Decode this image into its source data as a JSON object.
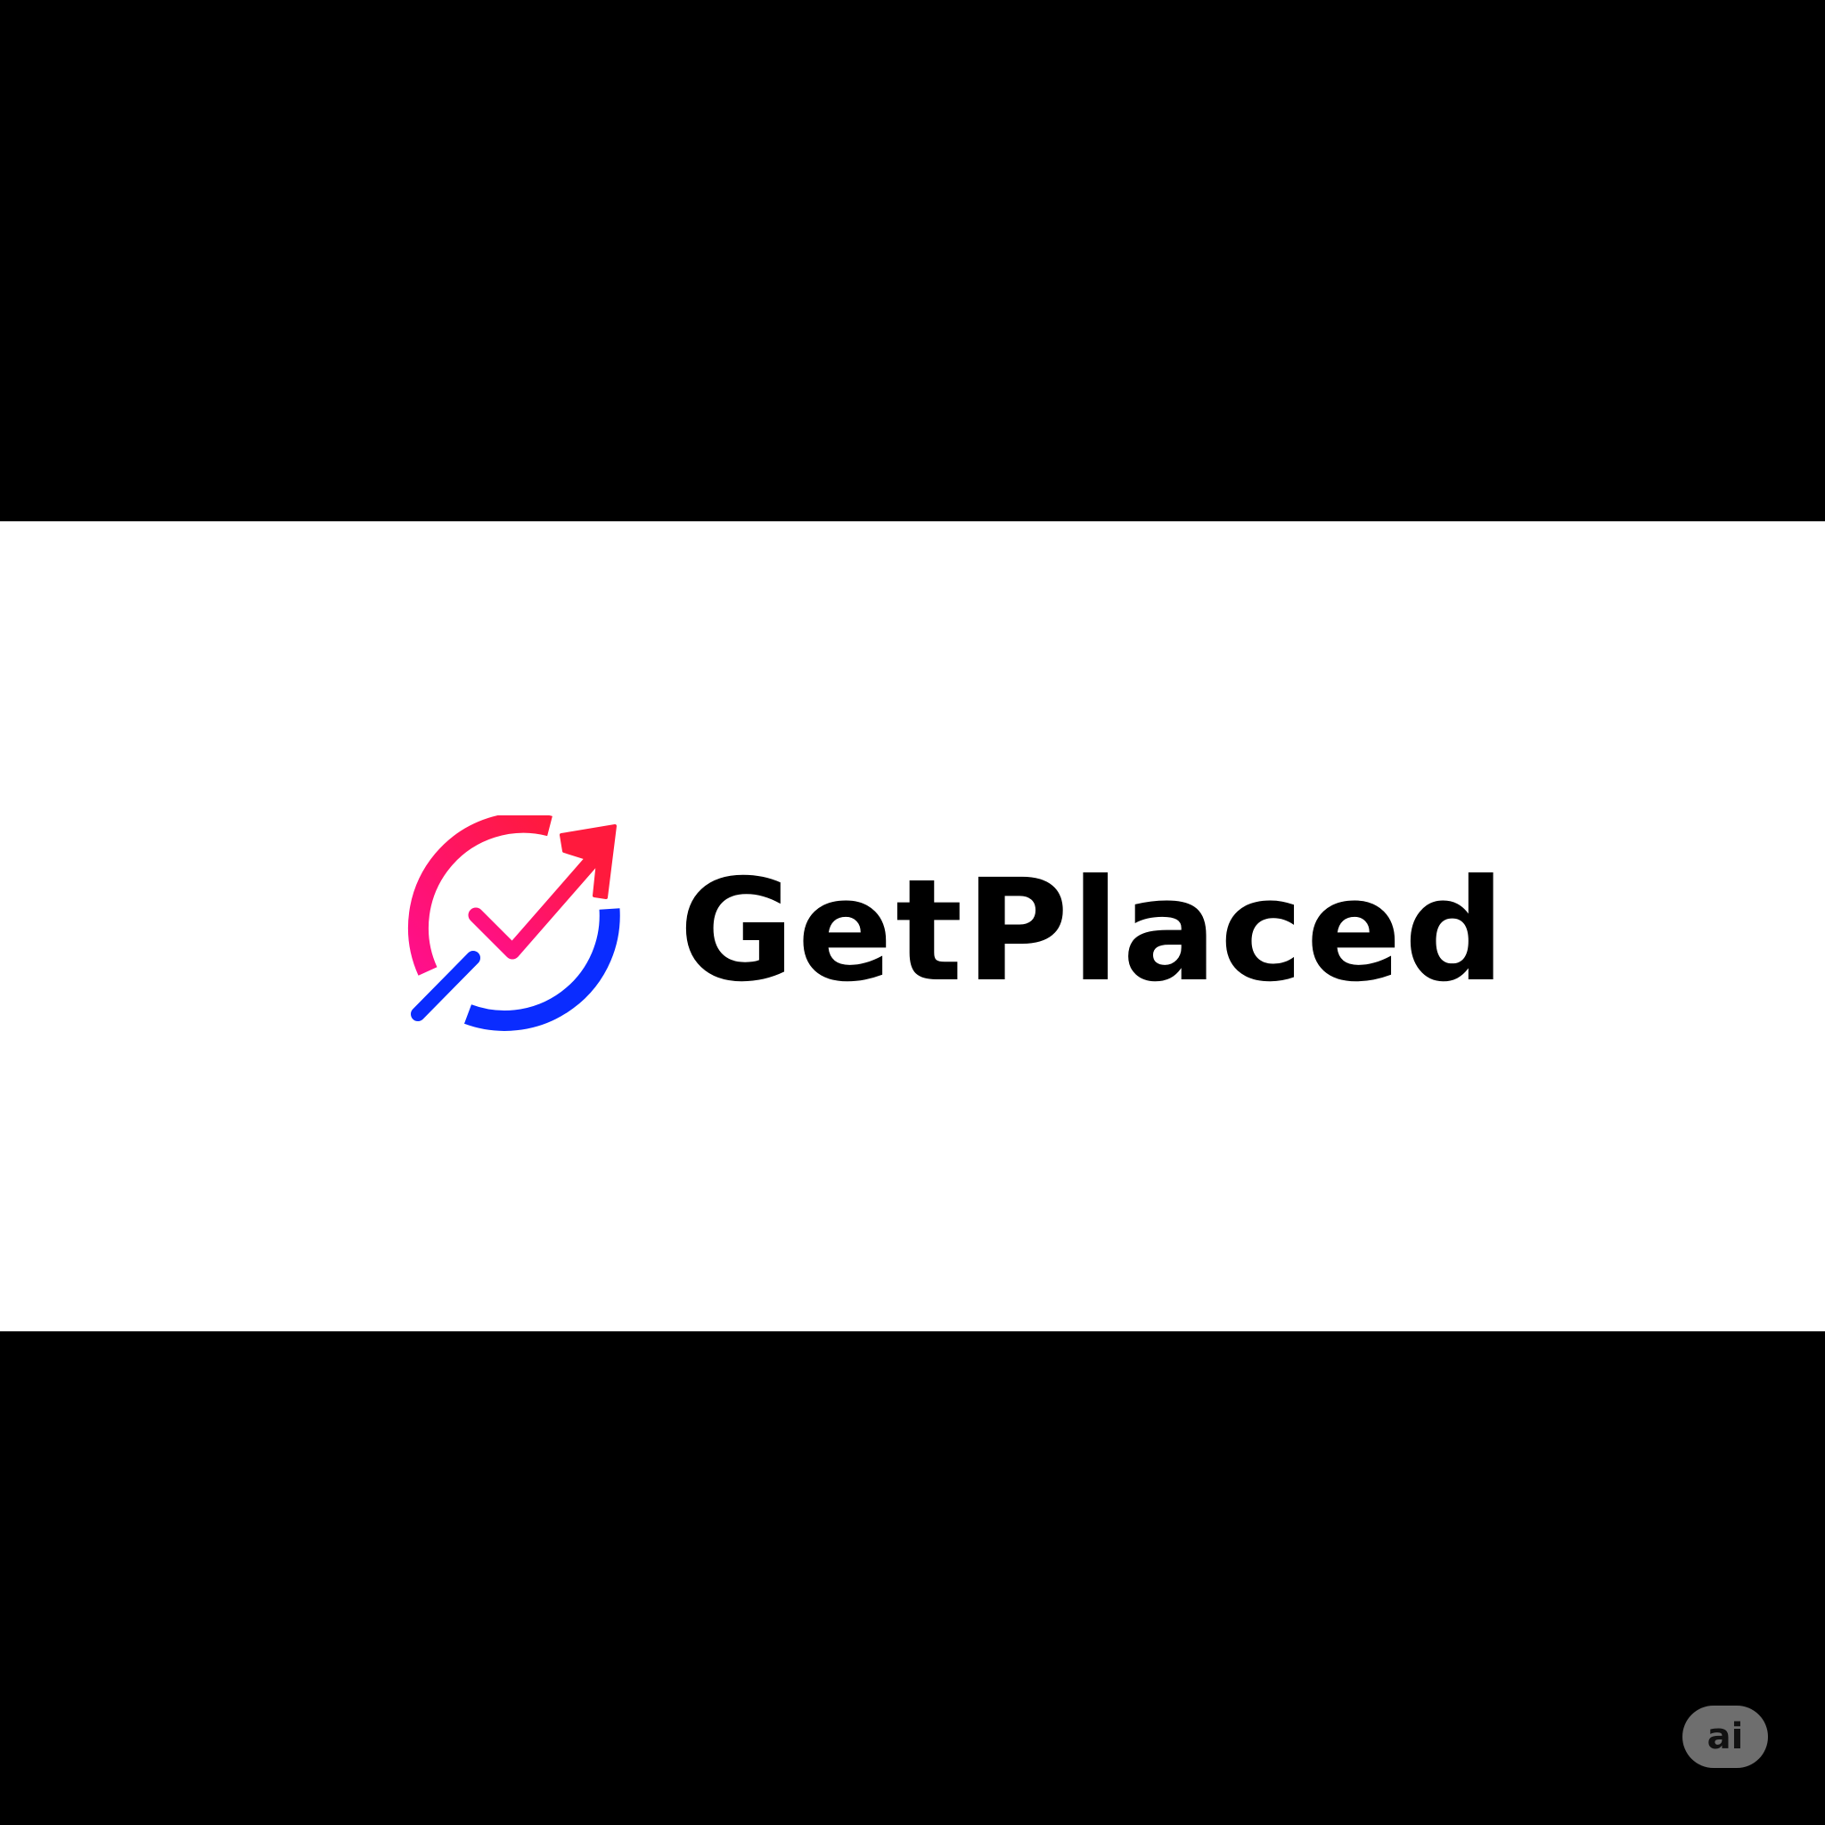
{
  "logo": {
    "wordmark": "GetPlaced",
    "icon": "circular-check-arrow-icon",
    "colors": {
      "gradient_start": "#ff1a3d",
      "gradient_mid": "#ff1a8a",
      "blue": "#0a2cff",
      "wordmark": "#000000",
      "band": "#ffffff",
      "background": "#000000"
    }
  },
  "badge": {
    "label": "ai"
  }
}
